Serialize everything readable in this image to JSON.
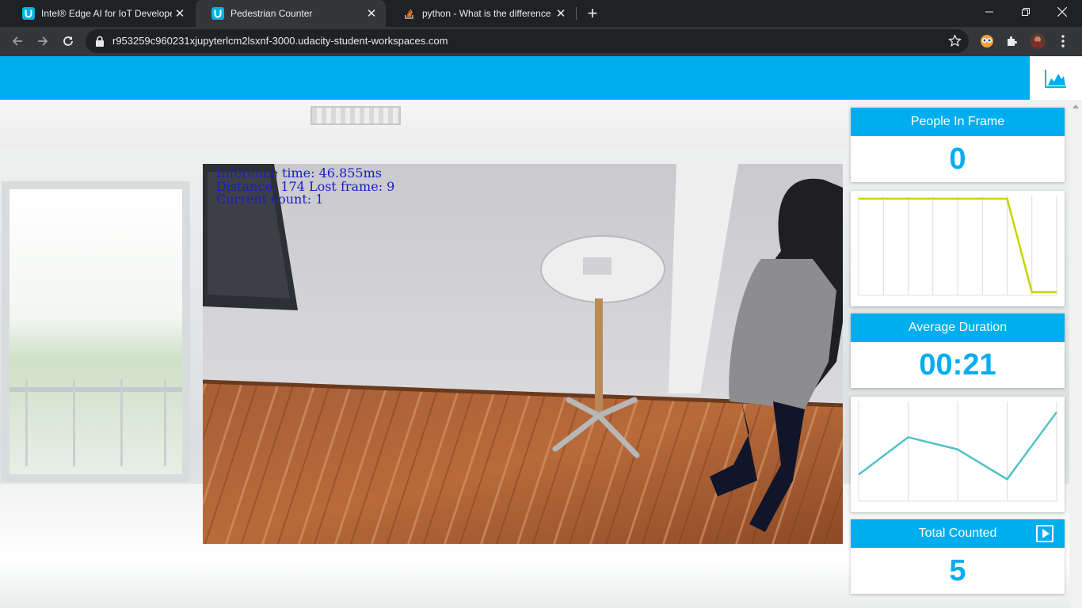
{
  "browser": {
    "tabs": [
      {
        "title": "Intel® Edge AI for IoT Developers",
        "icon": "udacity-icon",
        "active": false
      },
      {
        "title": "Pedestrian Counter",
        "icon": "udacity-icon",
        "active": true
      },
      {
        "title": "python - What is the difference b",
        "icon": "stackoverflow-icon",
        "active": false
      }
    ],
    "url": "r953259c960231xjupyterlcm2lsxnf-3000.udacity-student-workspaces.com"
  },
  "video_overlay": {
    "inference": "Inference time: 46.855ms",
    "distance": "Distance: 174 Lost frame: 9",
    "count": "Current count: 1"
  },
  "stats": {
    "people_in_frame": {
      "label": "People In Frame",
      "value": "0"
    },
    "average_duration": {
      "label": "Average Duration",
      "value": "00:21"
    },
    "total_counted": {
      "label": "Total Counted",
      "value": "5"
    }
  },
  "colors": {
    "accent": "#00adef",
    "people_line": "#c8d400",
    "duration_line": "#4fc3c7"
  },
  "chart_data": [
    {
      "type": "line",
      "series": [
        {
          "values": [
            1,
            1,
            1,
            1,
            1,
            1,
            1,
            0,
            0
          ]
        }
      ],
      "ylim": [
        0,
        1
      ],
      "grid": true
    },
    {
      "type": "line",
      "series": [
        {
          "values": [
            0.25,
            0.65,
            0.52,
            0.2,
            0.92
          ]
        }
      ],
      "ylim": [
        0,
        1
      ],
      "grid": true
    }
  ]
}
